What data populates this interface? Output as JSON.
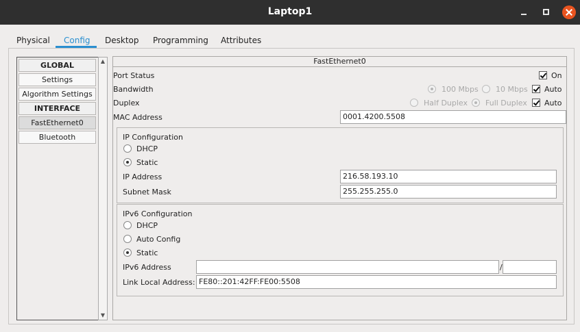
{
  "window": {
    "title": "Laptop1"
  },
  "tabs": [
    {
      "label": "Physical"
    },
    {
      "label": "Config"
    },
    {
      "label": "Desktop"
    },
    {
      "label": "Programming"
    },
    {
      "label": "Attributes"
    }
  ],
  "sidebar": {
    "items": [
      {
        "label": "GLOBAL"
      },
      {
        "label": "Settings"
      },
      {
        "label": "Algorithm Settings"
      },
      {
        "label": "INTERFACE"
      },
      {
        "label": "FastEthernet0"
      },
      {
        "label": "Bluetooth"
      }
    ]
  },
  "panel": {
    "title": "FastEthernet0",
    "port_status": {
      "label": "Port Status",
      "on_label": "On"
    },
    "bandwidth": {
      "label": "Bandwidth",
      "opt1": "100 Mbps",
      "opt2": "10 Mbps",
      "auto_label": "Auto"
    },
    "duplex": {
      "label": "Duplex",
      "opt1": "Half Duplex",
      "opt2": "Full Duplex",
      "auto_label": "Auto"
    },
    "mac": {
      "label": "MAC Address",
      "value": "0001.4200.5508"
    },
    "ipv4": {
      "title": "IP Configuration",
      "dhcp_label": "DHCP",
      "static_label": "Static",
      "ip_label": "IP Address",
      "ip_value": "216.58.193.10",
      "mask_label": "Subnet Mask",
      "mask_value": "255.255.255.0"
    },
    "ipv6": {
      "title": "IPv6 Configuration",
      "dhcp_label": "DHCP",
      "auto_label": "Auto Config",
      "static_label": "Static",
      "addr_label": "IPv6 Address",
      "addr_value": "",
      "prefix_value": "",
      "slash": "/",
      "link_local_label": "Link Local Address:",
      "link_local_value": "FE80::201:42FF:FE00:5508"
    }
  }
}
